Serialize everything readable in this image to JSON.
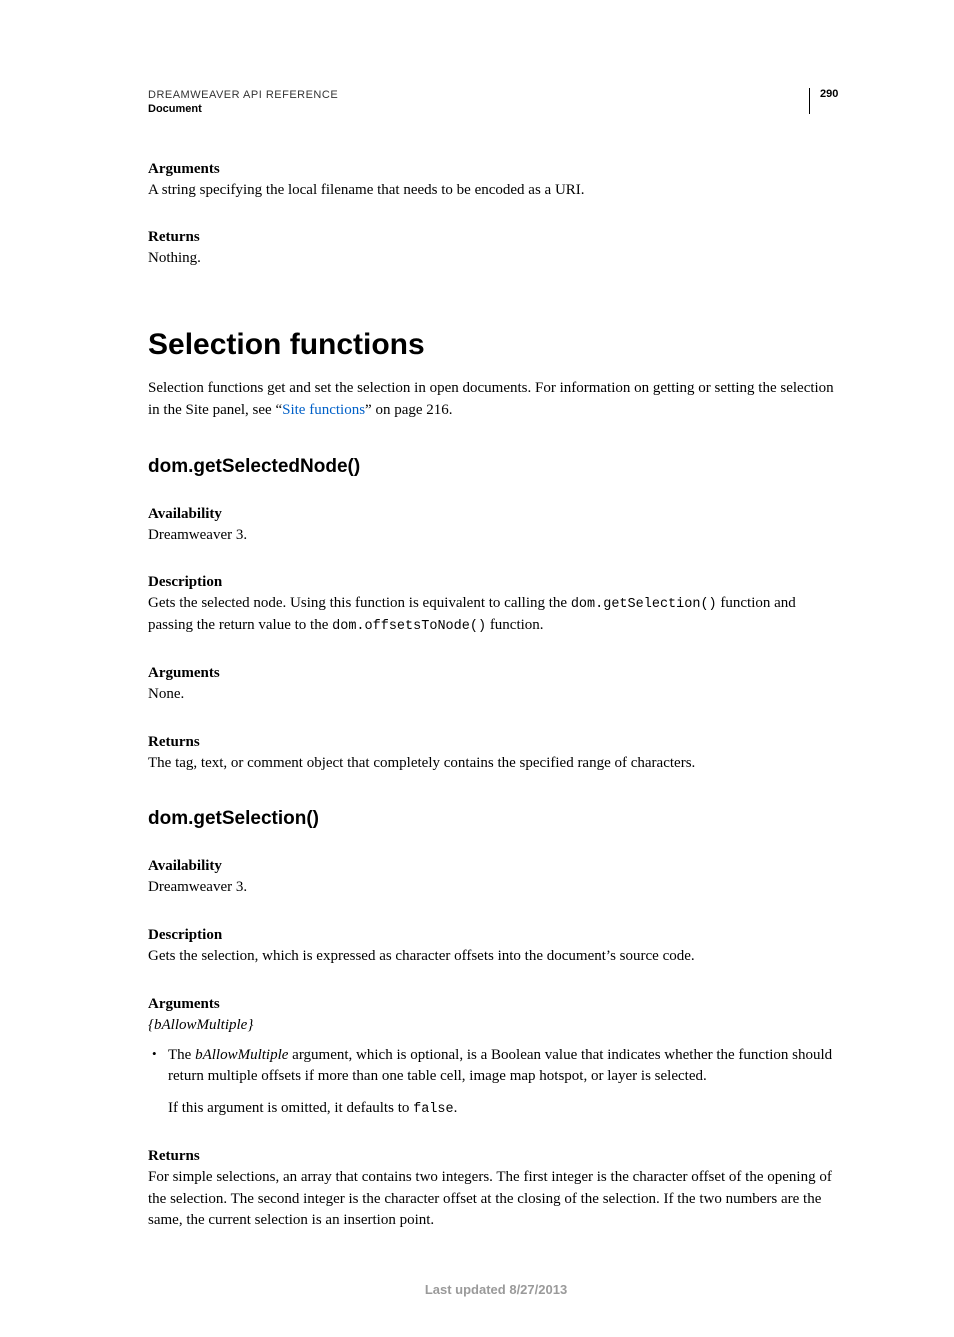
{
  "header": {
    "title": "DREAMWEAVER API REFERENCE",
    "section": "Document",
    "page_number": "290"
  },
  "intro_block": {
    "arguments_label": "Arguments",
    "arguments_text": "A string specifying the local filename that needs to be encoded as a URI.",
    "returns_label": "Returns",
    "returns_text": "Nothing."
  },
  "section_heading": "Selection functions",
  "section_intro_pre": "Selection functions get and set the selection in open documents. For information on getting or setting the selection in the Site panel, see “",
  "section_intro_link": "Site functions",
  "section_intro_post": "” on page 216.",
  "fn1": {
    "name": "dom.getSelectedNode()",
    "availability_label": "Availability",
    "availability_text": "Dreamweaver 3.",
    "description_label": "Description",
    "description_pre": "Gets the selected node. Using this function is equivalent to calling the ",
    "description_code1": "dom.getSelection()",
    "description_mid": " function and passing the return value to the ",
    "description_code2": "dom.offsetsToNode()",
    "description_post": " function.",
    "arguments_label": "Arguments",
    "arguments_text": "None.",
    "returns_label": "Returns",
    "returns_text": "The tag, text, or comment object that completely contains the specified range of characters."
  },
  "fn2": {
    "name": "dom.getSelection()",
    "availability_label": "Availability",
    "availability_text": "Dreamweaver 3.",
    "description_label": "Description",
    "description_text": "Gets the selection, which is expressed as character offsets into the document’s source code.",
    "arguments_label": "Arguments",
    "arguments_sig": "{bAllowMultiple}",
    "bullet_pre": "The ",
    "bullet_em": "bAllowMultiple",
    "bullet_post": " argument, which is optional, is a Boolean value that indicates whether the function should return multiple offsets if more than one table cell, image map hotspot, or layer is selected.",
    "bullet_sub_pre": "If this argument is omitted, it defaults to ",
    "bullet_sub_code": "false",
    "bullet_sub_post": ".",
    "returns_label": "Returns",
    "returns_text": "For simple selections, an array that contains two integers. The first integer is the character offset of the opening of the selection. The second integer is the character offset at the closing of the selection. If the two numbers are the same, the current selection is an insertion point."
  },
  "footer": "Last updated 8/27/2013"
}
